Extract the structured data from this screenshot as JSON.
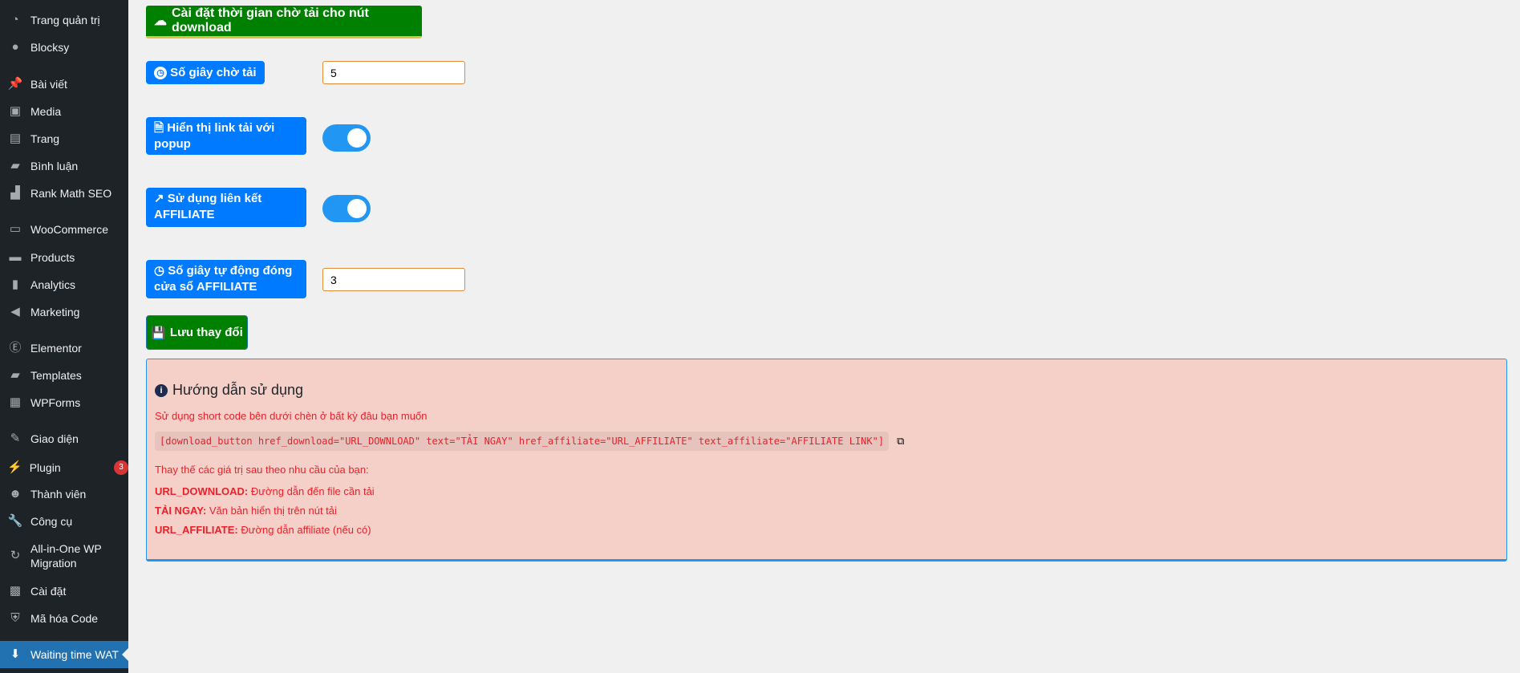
{
  "sidebar": {
    "items": [
      {
        "label": "Trang quản trị",
        "icon": "dashboard-icon"
      },
      {
        "label": "Blocksy",
        "icon": "blocksy-icon"
      },
      {
        "label": "Bài viết",
        "icon": "pin-icon"
      },
      {
        "label": "Media",
        "icon": "media-icon"
      },
      {
        "label": "Trang",
        "icon": "pages-icon"
      },
      {
        "label": "Bình luận",
        "icon": "comments-icon"
      },
      {
        "label": "Rank Math SEO",
        "icon": "rankmath-icon"
      },
      {
        "label": "WooCommerce",
        "icon": "woocommerce-icon"
      },
      {
        "label": "Products",
        "icon": "products-icon"
      },
      {
        "label": "Analytics",
        "icon": "analytics-icon"
      },
      {
        "label": "Marketing",
        "icon": "megaphone-icon"
      },
      {
        "label": "Elementor",
        "icon": "elementor-icon"
      },
      {
        "label": "Templates",
        "icon": "folder-icon"
      },
      {
        "label": "WPForms",
        "icon": "wpforms-icon"
      },
      {
        "label": "Giao diện",
        "icon": "brush-icon"
      },
      {
        "label": "Plugin",
        "icon": "plugin-icon",
        "badge": "3"
      },
      {
        "label": "Thành viên",
        "icon": "user-icon"
      },
      {
        "label": "Công cụ",
        "icon": "wrench-icon"
      },
      {
        "label": "All-in-One WP Migration",
        "icon": "migration-icon"
      },
      {
        "label": "Cài đặt",
        "icon": "settings-icon"
      },
      {
        "label": "Mã hóa Code",
        "icon": "shield-icon"
      },
      {
        "label": "Waiting time WAT",
        "icon": "download-icon",
        "active": true
      }
    ]
  },
  "main": {
    "header_button": "Cài đặt thời gian chờ tải cho nút download",
    "wait_seconds_label": "Số giây chờ tải",
    "wait_seconds_value": "5",
    "popup_label": "Hiển thị link tải với popup",
    "popup_enabled": true,
    "affiliate_label": "Sử dụng liên kết AFFILIATE",
    "affiliate_enabled": true,
    "auto_close_label": "Số giây tự động đóng cửa sổ AFFILIATE",
    "auto_close_value": "3",
    "save_label": "Lưu thay đổi"
  },
  "guide": {
    "title": "Hướng dẫn sử dụng",
    "intro": "Sử dụng short code bên dưới chèn ở bất kỳ đâu bạn muốn",
    "shortcode": "[download_button href_download=\"URL_DOWNLOAD\" text=\"TẢI NGAY\" href_affiliate=\"URL_AFFILIATE\" text_affiliate=\"AFFILIATE LINK\"]",
    "replace_intro": "Thay thế các giá trị sau theo nhu cầu của bạn:",
    "params": [
      {
        "key": "URL_DOWNLOAD:",
        "desc": " Đường dẫn đến file cần tải"
      },
      {
        "key": "TẢI NGAY:",
        "desc": " Văn bản hiển thị trên nút tải"
      },
      {
        "key": "URL_AFFILIATE:",
        "desc": " Đường dẫn affiliate (nếu có)"
      }
    ]
  },
  "colors": {
    "sidebar": "#1d2327",
    "primary": "#007bff",
    "success": "#008000",
    "guide_bg": "#f5d0c8",
    "guide_text": "#e8212b"
  }
}
